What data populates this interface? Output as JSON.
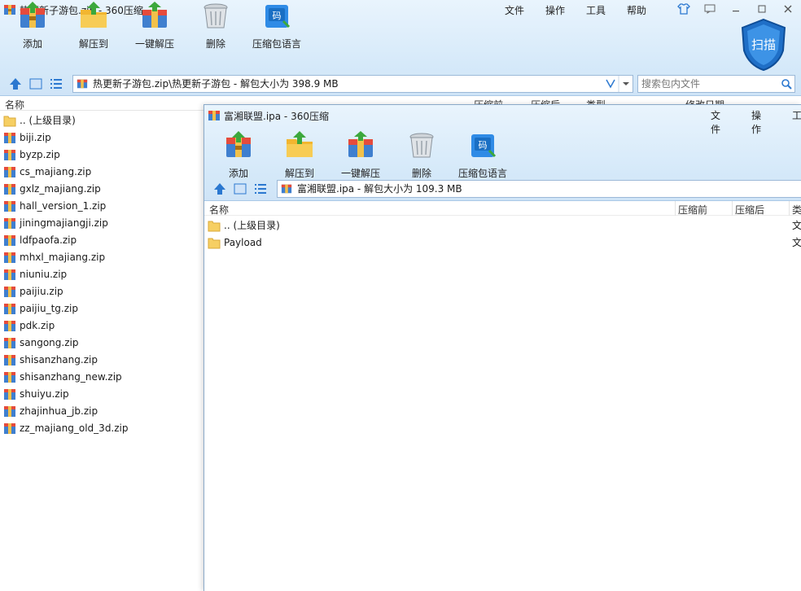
{
  "outer": {
    "title": "热更新子游包.zip - 360压缩",
    "menu": [
      "文件",
      "操作",
      "工具",
      "帮助"
    ],
    "toolbar": {
      "add": "添加",
      "extract_to": "解压到",
      "one_click_extract": "一键解压",
      "delete": "删除",
      "archive_language": "压缩包语言"
    },
    "scan_label": "扫描",
    "address": "热更新子游包.zip\\热更新子游包 - 解包大小为 398.9 MB",
    "search_placeholder": "搜索包内文件",
    "columns": {
      "name": "名称",
      "before": "压缩前",
      "after": "压缩后",
      "type": "类型",
      "modified": "修改日期"
    },
    "files": [
      ".. (上级目录)",
      "biji.zip",
      "byzp.zip",
      "cs_majiang.zip",
      "gxlz_majiang.zip",
      "hall_version_1.zip",
      "jiningmajiangji.zip",
      "ldfpaofa.zip",
      "mhxl_majiang.zip",
      "niuniu.zip",
      "paijiu.zip",
      "paijiu_tg.zip",
      "pdk.zip",
      "sangong.zip",
      "shisanzhang.zip",
      "shisanzhang_new.zip",
      "shuiyu.zip",
      "zhajinhua_jb.zip",
      "zz_majiang_old_3d.zip"
    ]
  },
  "inner": {
    "title": "富湘联盟.ipa - 360压缩",
    "menu": [
      "文件",
      "操作",
      "工"
    ],
    "toolbar": {
      "add": "添加",
      "extract_to": "解压到",
      "one_click_extract": "一键解压",
      "delete": "删除",
      "archive_language": "压缩包语言"
    },
    "address": "富湘联盟.ipa - 解包大小为 109.3 MB",
    "columns": {
      "name": "名称",
      "before": "压缩前",
      "after": "压缩后",
      "type": "类"
    },
    "files": [
      {
        "name": ".. (上级目录)",
        "type": "文"
      },
      {
        "name": "Payload",
        "type": "文"
      }
    ]
  },
  "colors": {
    "chrome_top": "#e9f4fd",
    "chrome_bottom": "#cfe4f7",
    "accent": "#2b78d0"
  },
  "icons": {
    "title": "archive-icon",
    "add": "add-to-archive-icon",
    "extract_to": "extract-to-folder-icon",
    "one_click_extract": "one-click-extract-icon",
    "delete": "trash-bin-icon",
    "archive_language": "code-language-icon",
    "scan": "shield-scan-icon",
    "up": "up-arrow-icon",
    "view_thumb": "thumbnail-view-icon",
    "view_list": "list-view-icon",
    "search": "magnifier-icon",
    "folder": "folder-icon",
    "zip": "zip-file-icon"
  }
}
